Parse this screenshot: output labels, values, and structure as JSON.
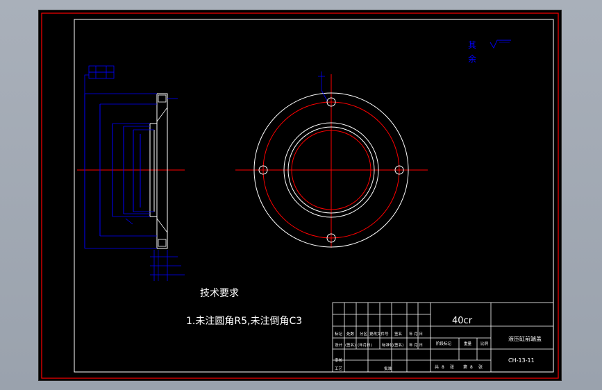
{
  "drawing": {
    "roughness_note": [
      "其",
      "余"
    ],
    "tech_title": "技术要求",
    "tech_note": "1.未注圆角R5,未注倒角C3",
    "material": "40cr",
    "part_name": "液压缸前端盖",
    "drawing_no": "CH-13-11",
    "title_block_row1": [
      "标记",
      "处数",
      "分区",
      "更改文件号",
      "签名",
      "年 月 日"
    ],
    "title_block_row2": [
      "设计",
      "(签名)",
      "(年月日)",
      "标准化",
      "(签名)",
      "年 月 日"
    ],
    "title_block_stage": [
      "阶段标记",
      "重量",
      "比例"
    ],
    "title_block_left": [
      "审核",
      "工艺"
    ],
    "title_block_approve": "批准",
    "sheet_info": [
      "共",
      "张",
      "第",
      "张"
    ],
    "sheet_nums": [
      "8",
      "8"
    ]
  },
  "colors": {
    "frame": "#ff0000",
    "geometry": "#ffffff",
    "centerline": "#ff0000",
    "dimension": "#0000ff",
    "text": "#ffffff"
  }
}
